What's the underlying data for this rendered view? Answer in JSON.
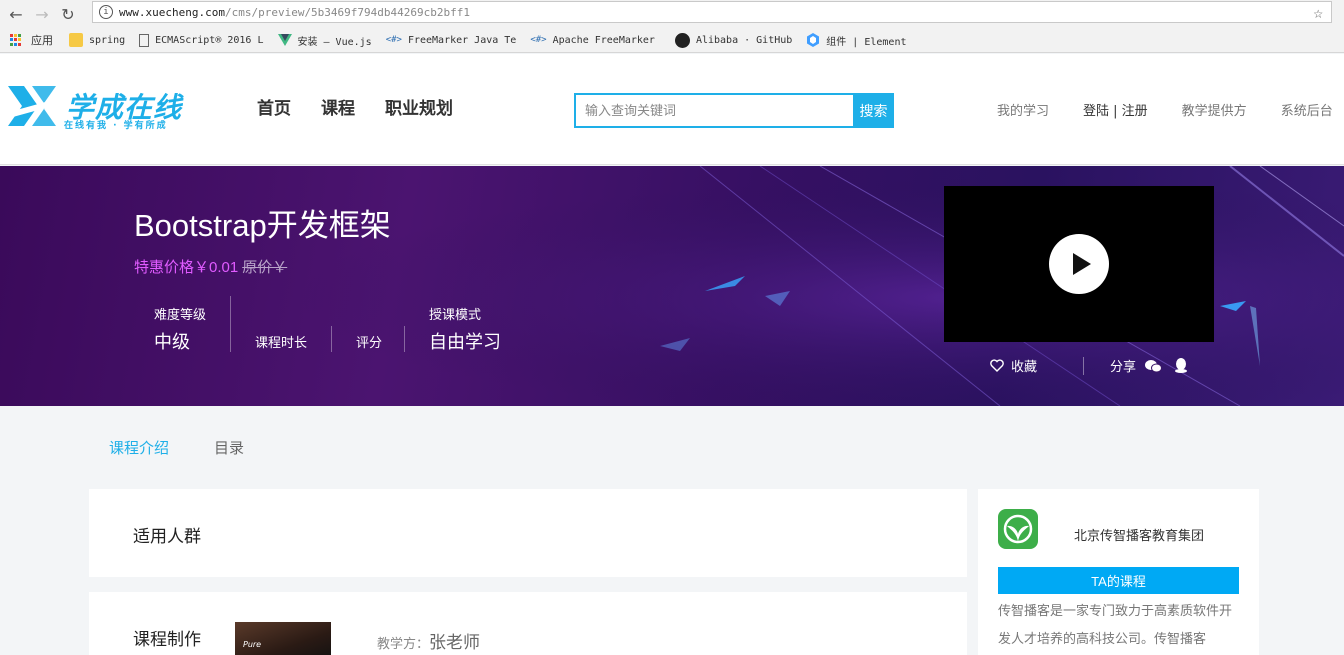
{
  "browser": {
    "url_host": "www.xuecheng.com",
    "url_path": "/cms/preview/5b3469f794db44269cb2bff1",
    "bookmarks": [
      {
        "label": "应用",
        "icon": "apps-grid-icon"
      },
      {
        "label": "spring",
        "icon": "folder-icon"
      },
      {
        "label": "ECMAScript® 2016 L",
        "icon": "page-icon"
      },
      {
        "label": "安装 — Vue.js",
        "icon": "vue-icon"
      },
      {
        "label": "FreeMarker Java Te",
        "icon": "code-icon"
      },
      {
        "label": "Apache FreeMarker",
        "icon": "code-icon"
      },
      {
        "label": "Alibaba · GitHub",
        "icon": "github-icon"
      },
      {
        "label": "组件 | Element",
        "icon": "element-icon"
      }
    ]
  },
  "header": {
    "logo_text": "学成在线",
    "logo_slogan": "在线有我 · 学有所成",
    "nav": [
      "首页",
      "课程",
      "职业规划"
    ],
    "search_placeholder": "输入查询关键词",
    "search_button": "搜索",
    "user_nav": {
      "my_learning": "我的学习",
      "login": "登陆 | 注册",
      "provider": "教学提供方",
      "backend": "系统后台"
    }
  },
  "course": {
    "title": "Bootstrap开发框架",
    "price_label": "特惠价格￥0.01",
    "original_price": "原价￥",
    "attrs": {
      "difficulty_label": "难度等级",
      "difficulty_value": "中级",
      "duration_label": "课程时长",
      "rating_label": "评分",
      "mode_label": "授课模式",
      "mode_value": "自由学习"
    },
    "actions": {
      "favorite": "收藏",
      "share": "分享"
    }
  },
  "tabs": [
    {
      "label": "课程介绍",
      "active": true
    },
    {
      "label": "目录",
      "active": false
    }
  ],
  "sections": {
    "audience_title": "适用人群",
    "production_title": "课程制作",
    "teacher_photo_text": "Pure",
    "teacher_label": "教学方：",
    "teacher_name": "张老师"
  },
  "organization": {
    "name": "北京传智播客教育集团",
    "courses_button": "TA的课程",
    "description": "传智播客是一家专门致力于高素质软件开发人才培养的高科技公司。传智播客"
  },
  "colors": {
    "accent": "#1eafe8",
    "price": "#e05bff",
    "org_green": "#3dae49"
  }
}
